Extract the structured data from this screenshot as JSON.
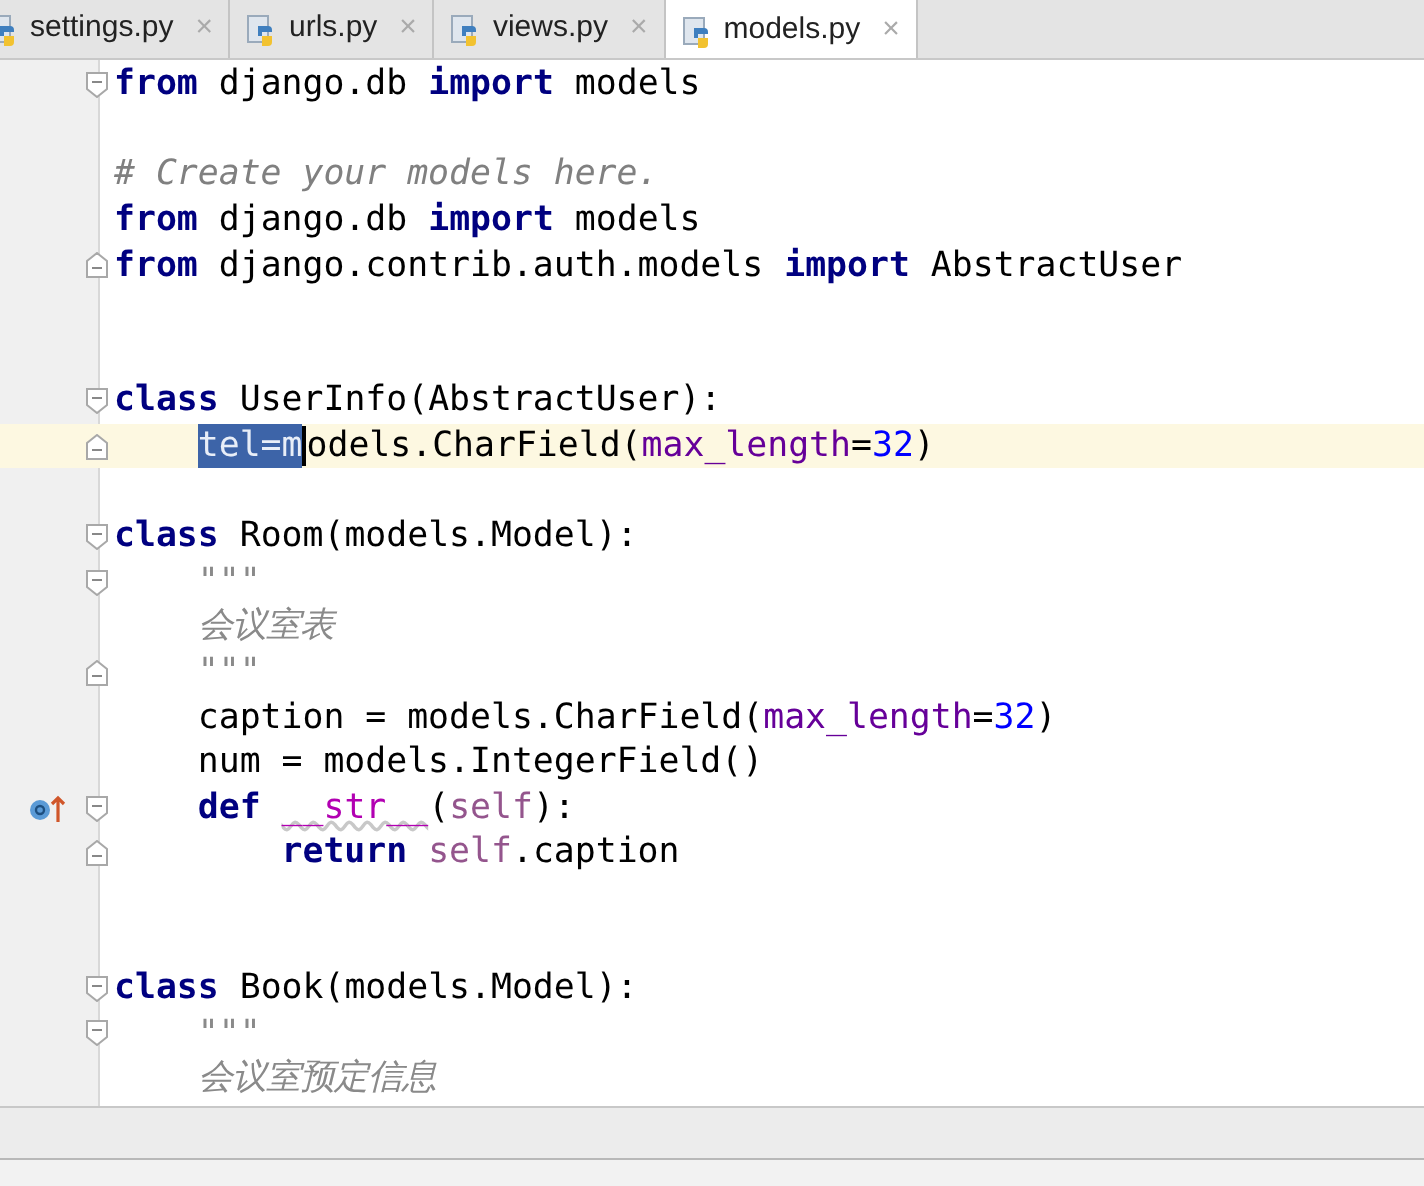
{
  "tabs": [
    {
      "label": "settings.py",
      "close": "×",
      "selected": false
    },
    {
      "label": "urls.py",
      "close": "×",
      "selected": false
    },
    {
      "label": "views.py",
      "close": "×",
      "selected": false
    },
    {
      "label": "models.py",
      "close": "×",
      "selected": true
    }
  ],
  "lines": [
    {
      "kind": "code",
      "current": false,
      "fold_start": true,
      "fold_end": false,
      "overrides": false,
      "tokens": [
        {
          "text": "from",
          "kind": "keyword"
        },
        {
          "text": " django.db ",
          "kind": "plain"
        },
        {
          "text": "import",
          "kind": "keyword"
        },
        {
          "text": " models",
          "kind": "plain"
        }
      ]
    },
    {
      "kind": "blank",
      "current": false,
      "fold_start": false,
      "fold_end": false,
      "overrides": false
    },
    {
      "kind": "code",
      "current": false,
      "fold_start": false,
      "fold_end": false,
      "overrides": false,
      "tokens": [
        {
          "text": "# Create your models here.",
          "kind": "comment"
        }
      ]
    },
    {
      "kind": "code",
      "current": false,
      "fold_start": false,
      "fold_end": false,
      "overrides": false,
      "tokens": [
        {
          "text": "from",
          "kind": "keyword"
        },
        {
          "text": " django.db ",
          "kind": "plain"
        },
        {
          "text": "import",
          "kind": "keyword"
        },
        {
          "text": " models",
          "kind": "plain"
        }
      ]
    },
    {
      "kind": "code",
      "current": false,
      "fold_start": false,
      "fold_end": true,
      "overrides": false,
      "tokens": [
        {
          "text": "from",
          "kind": "keyword"
        },
        {
          "text": " django.contrib.auth.models ",
          "kind": "plain"
        },
        {
          "text": "import",
          "kind": "keyword"
        },
        {
          "text": " AbstractUser",
          "kind": "plain"
        }
      ]
    },
    {
      "kind": "blank",
      "current": false,
      "fold_start": false,
      "fold_end": false,
      "overrides": false
    },
    {
      "kind": "blank",
      "current": false,
      "fold_start": false,
      "fold_end": false,
      "overrides": false
    },
    {
      "kind": "code",
      "current": false,
      "fold_start": true,
      "fold_end": false,
      "overrides": false,
      "tokens": [
        {
          "text": "class",
          "kind": "keyword"
        },
        {
          "text": " UserInfo(AbstractUser):",
          "kind": "plain"
        }
      ]
    },
    {
      "kind": "code",
      "current": true,
      "fold_start": false,
      "fold_end": true,
      "overrides": false,
      "tokens": [
        {
          "text": "    tel=m",
          "kind": "selected"
        },
        {
          "text": "odels.CharField(",
          "kind": "plain"
        },
        {
          "text": "max_length",
          "kind": "param"
        },
        {
          "text": "=",
          "kind": "plain"
        },
        {
          "text": "32",
          "kind": "number"
        },
        {
          "text": ")",
          "kind": "plain"
        }
      ]
    },
    {
      "kind": "blank",
      "current": false,
      "fold_start": false,
      "fold_end": false,
      "overrides": false
    },
    {
      "kind": "code",
      "current": false,
      "fold_start": true,
      "fold_end": false,
      "overrides": false,
      "tokens": [
        {
          "text": "class",
          "kind": "keyword"
        },
        {
          "text": " Room(models.Model):",
          "kind": "plain"
        }
      ]
    },
    {
      "kind": "code",
      "current": false,
      "fold_start": true,
      "fold_end": false,
      "overrides": false,
      "tokens": [
        {
          "text": "    \"\"\"",
          "kind": "docstring"
        }
      ]
    },
    {
      "kind": "code",
      "current": false,
      "fold_start": false,
      "fold_end": false,
      "overrides": false,
      "tokens": [
        {
          "text": "    会议室表",
          "kind": "docstring"
        }
      ]
    },
    {
      "kind": "code",
      "current": false,
      "fold_start": false,
      "fold_end": true,
      "overrides": false,
      "tokens": [
        {
          "text": "    \"\"\"",
          "kind": "docstring"
        }
      ]
    },
    {
      "kind": "code",
      "current": false,
      "fold_start": false,
      "fold_end": false,
      "overrides": false,
      "tokens": [
        {
          "text": "    caption = models.CharField(",
          "kind": "plain"
        },
        {
          "text": "max_length",
          "kind": "param"
        },
        {
          "text": "=",
          "kind": "plain"
        },
        {
          "text": "32",
          "kind": "number"
        },
        {
          "text": ")",
          "kind": "plain"
        }
      ]
    },
    {
      "kind": "code",
      "current": false,
      "fold_start": false,
      "fold_end": false,
      "overrides": false,
      "tokens": [
        {
          "text": "    num = models.IntegerField()",
          "kind": "plain"
        }
      ]
    },
    {
      "kind": "code",
      "current": false,
      "fold_start": true,
      "fold_end": false,
      "overrides": true,
      "tokens": [
        {
          "text": "    def ",
          "kind": "keyword"
        },
        {
          "text": "__str__",
          "kind": "magic"
        },
        {
          "text": "(",
          "kind": "plain"
        },
        {
          "text": "self",
          "kind": "self"
        },
        {
          "text": "):",
          "kind": "plain"
        }
      ]
    },
    {
      "kind": "code",
      "current": false,
      "fold_start": false,
      "fold_end": true,
      "overrides": false,
      "tokens": [
        {
          "text": "        return ",
          "kind": "keyword"
        },
        {
          "text": "self",
          "kind": "self"
        },
        {
          "text": ".caption",
          "kind": "plain"
        }
      ]
    },
    {
      "kind": "blank",
      "current": false,
      "fold_start": false,
      "fold_end": false,
      "overrides": false
    },
    {
      "kind": "blank",
      "current": false,
      "fold_start": false,
      "fold_end": false,
      "overrides": false
    },
    {
      "kind": "code",
      "current": false,
      "fold_start": true,
      "fold_end": false,
      "overrides": false,
      "tokens": [
        {
          "text": "class",
          "kind": "keyword"
        },
        {
          "text": " Book(models.Model):",
          "kind": "plain"
        }
      ]
    },
    {
      "kind": "code",
      "current": false,
      "fold_start": true,
      "fold_end": false,
      "overrides": false,
      "tokens": [
        {
          "text": "    \"\"\"",
          "kind": "docstring"
        }
      ]
    },
    {
      "kind": "code",
      "current": false,
      "fold_start": false,
      "fold_end": false,
      "overrides": false,
      "tokens": [
        {
          "text": "    会议室预定信息",
          "kind": "docstring"
        }
      ]
    }
  ]
}
